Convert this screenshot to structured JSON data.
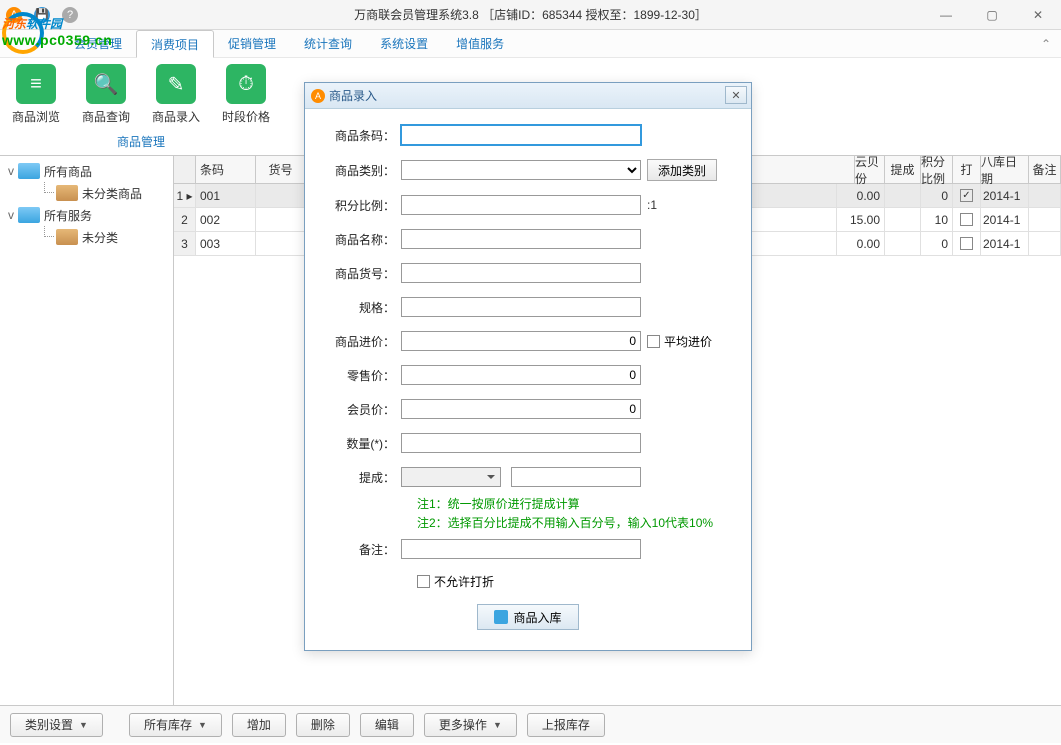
{
  "window": {
    "title": "万商联会员管理系统3.8  ［店铺ID：685344 授权至：1899-12-30］"
  },
  "watermark": {
    "text_part1": "河东",
    "text_part2": "软件园",
    "url": "www.pc0359.cn"
  },
  "menu": {
    "items": [
      "会员管理",
      "消费项目",
      "促销管理",
      "统计查询",
      "系统设置",
      "增值服务"
    ],
    "active_index": 1
  },
  "ribbon": {
    "buttons": [
      {
        "label": "商品浏览",
        "icon": "≡"
      },
      {
        "label": "商品查询",
        "icon": "🔍"
      },
      {
        "label": "商品录入",
        "icon": "✎"
      },
      {
        "label": "时段价格",
        "icon": "⏱"
      }
    ],
    "group_label": "商品管理"
  },
  "tree": {
    "nodes": [
      {
        "label": "所有商品",
        "expanded": true,
        "children": [
          {
            "label": "未分类商品"
          }
        ]
      },
      {
        "label": "所有服务",
        "expanded": true,
        "children": [
          {
            "label": "未分类"
          }
        ]
      }
    ]
  },
  "grid": {
    "headers": {
      "barcode": "条码",
      "sku": "货号",
      "memprice": "云贝份",
      "tc": "提成",
      "pct": "积分比例",
      "chk": "打",
      "date": "八库日期",
      "remark": "备注"
    },
    "rows": [
      {
        "idx": 1,
        "barcode": "001",
        "sku": "",
        "memprice": "0.00",
        "tc": "",
        "pct": "0",
        "chk": true,
        "date": "2014-1",
        "selected": true
      },
      {
        "idx": 2,
        "barcode": "002",
        "sku": "",
        "memprice": "15.00",
        "tc": "",
        "pct": "10",
        "chk": false,
        "date": "2014-1",
        "selected": false
      },
      {
        "idx": 3,
        "barcode": "003",
        "sku": "",
        "memprice": "0.00",
        "tc": "",
        "pct": "0",
        "chk": false,
        "date": "2014-1",
        "selected": false
      }
    ]
  },
  "bottombar": {
    "category_setting": "类别设置",
    "stock_filter": "所有库存",
    "add": "增加",
    "delete": "删除",
    "edit": "编辑",
    "more": "更多操作",
    "report": "上报库存"
  },
  "dialog": {
    "title": "商品录入",
    "fields": {
      "barcode": {
        "label": "商品条码：",
        "value": ""
      },
      "category": {
        "label": "商品类别：",
        "value": "",
        "add_btn": "添加类别"
      },
      "points_ratio": {
        "label": "积分比例：",
        "value": "",
        "suffix": ":1"
      },
      "name": {
        "label": "商品名称：",
        "value": ""
      },
      "sku": {
        "label": "商品货号：",
        "value": ""
      },
      "spec": {
        "label": "规格：",
        "value": ""
      },
      "cost": {
        "label": "商品进价：",
        "value": "0",
        "avg_checkbox": "平均进价"
      },
      "retail": {
        "label": "零售价：",
        "value": "0"
      },
      "vip": {
        "label": "会员价：",
        "value": "0"
      },
      "qty": {
        "label": "数量(*)：",
        "value": ""
      },
      "commission": {
        "label": "提成：",
        "value": ""
      },
      "remark": {
        "label": "备注：",
        "value": ""
      }
    },
    "notes": {
      "n1": "注1：统一按原价进行提成计算",
      "n2": "注2：选择百分比提成不用输入百分号，输入10代表10%"
    },
    "no_discount": "不允许打折",
    "submit": "商品入库"
  }
}
